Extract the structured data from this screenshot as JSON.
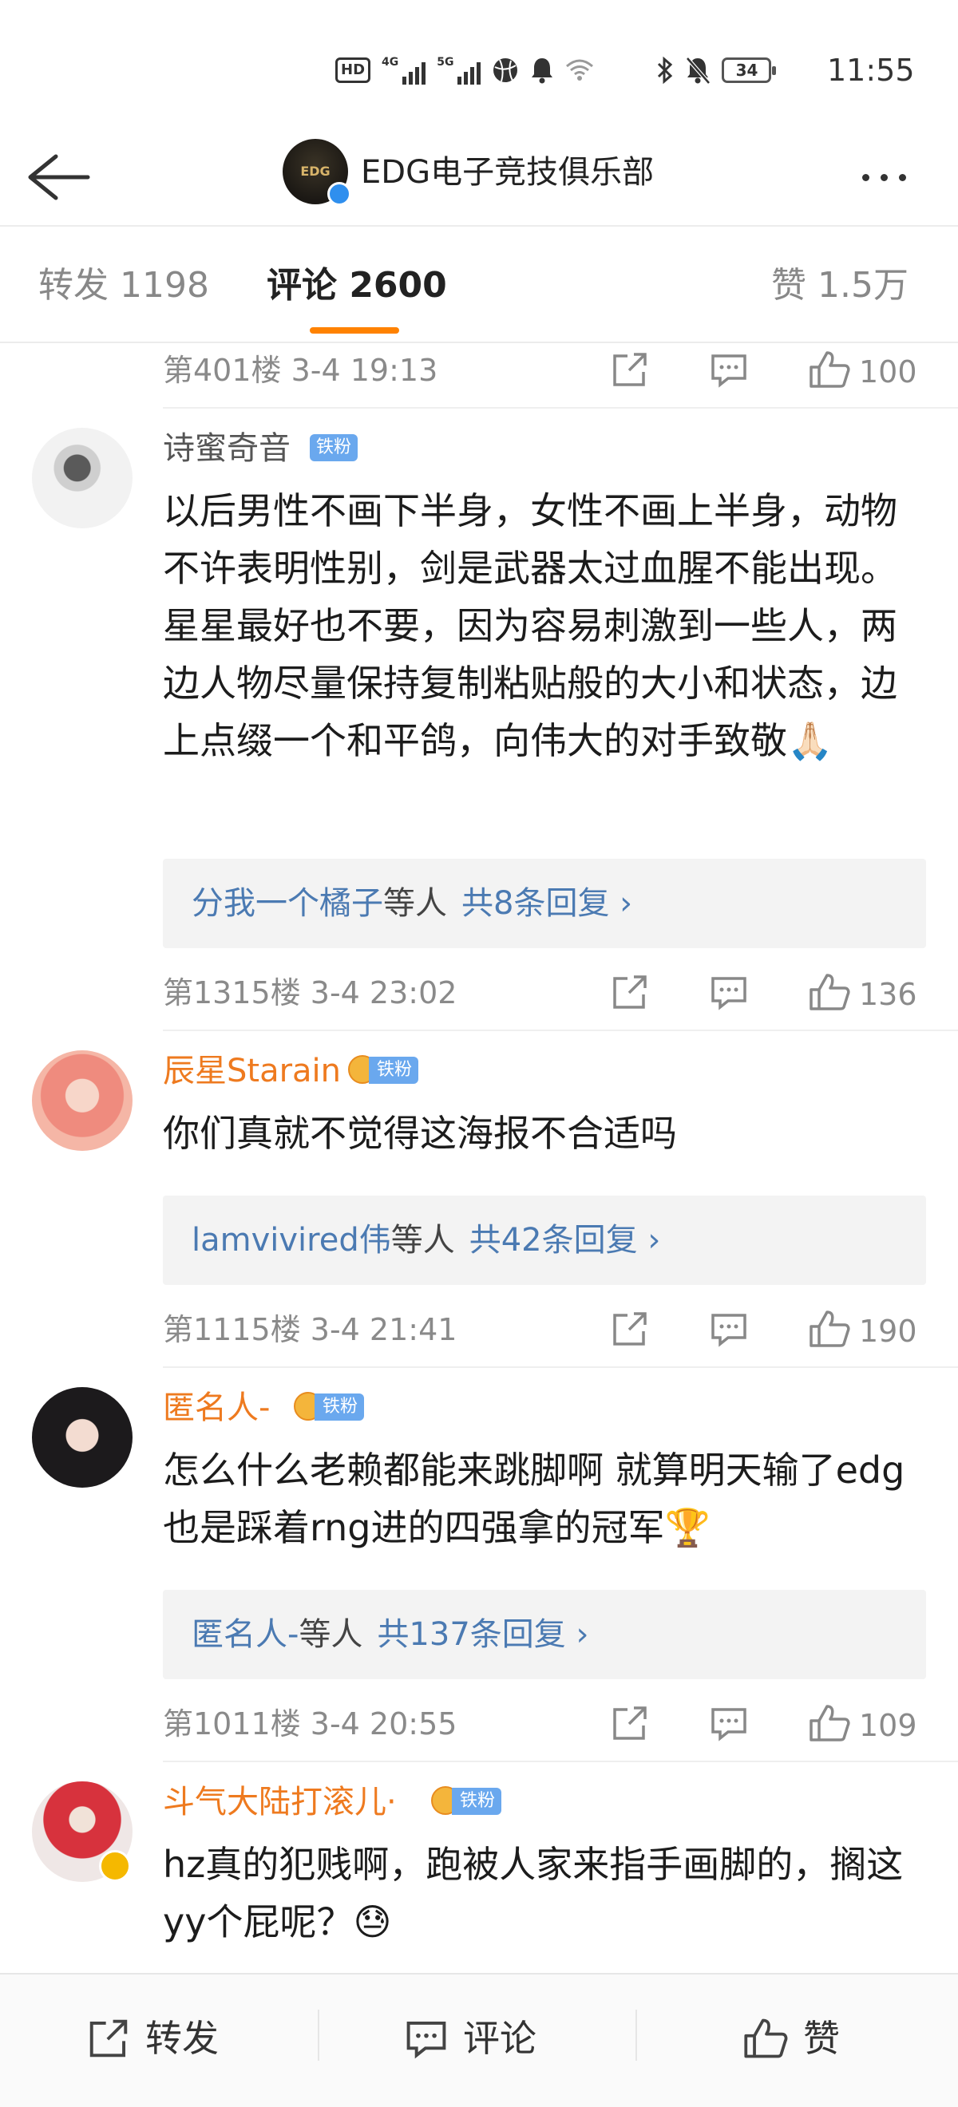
{
  "status_bar": {
    "hd_badge": "HD",
    "sim1": "4G",
    "sim2": "5G",
    "battery": "34",
    "time": "11:55"
  },
  "header": {
    "club_avatar_text": "EDG",
    "club_name": "EDG电子竞技俱乐部"
  },
  "tabs": {
    "repost": "转发 1198",
    "comments": "评论 2600",
    "likes": "赞 1.5万"
  },
  "comments": [
    {
      "floor_meta": "第401楼 3-4 19:13",
      "likes": "100"
    },
    {
      "user": "诗蜜奇音",
      "badge": "铁粉",
      "text": "以后男性不画下半身，女性不画上半身，动物不许表明性别，剑是武器太过血腥不能出现。星星最好也不要，因为容易刺激到一些人，两边人物尽量保持复制粘贴般的大小和状态，边上点缀一个和平鸽，向伟大的对手致敬🙏🏻",
      "reply_who": "分我一个橘子",
      "reply_etc": "等人",
      "reply_count": "共8条回复 ›",
      "floor_meta": "第1315楼 3-4 23:02",
      "likes": "136"
    },
    {
      "user": "辰星Starain",
      "badge": "铁粉",
      "text": "你们真就不觉得这海报不合适吗",
      "reply_who": "lamvivired伟",
      "reply_etc": "等人",
      "reply_count": "共42条回复 ›",
      "floor_meta": "第1115楼 3-4 21:41",
      "likes": "190"
    },
    {
      "user": "匿名人-",
      "badge": "铁粉",
      "text": "怎么什么老赖都能来跳脚啊 就算明天输了edg也是踩着rng进的四强拿的冠军🏆",
      "reply_who": "匿名人-",
      "reply_etc": "等人",
      "reply_count": "共137条回复 ›",
      "floor_meta": "第1011楼 3-4 20:55",
      "likes": "109"
    },
    {
      "user": "斗气大陆打滚儿·",
      "badge": "铁粉",
      "text": "hz真的犯贱啊，跑被人家来指手画脚的，搁这yy个屁呢？😓"
    }
  ],
  "bottom_bar": {
    "repost": "转发",
    "comment": "评论",
    "like": "赞"
  },
  "colors": {
    "accent_orange": "#ff8200",
    "link_blue": "#4b7ab2",
    "fan_badge_blue": "#6aa8ee",
    "username_orange": "#ee7a1f"
  }
}
